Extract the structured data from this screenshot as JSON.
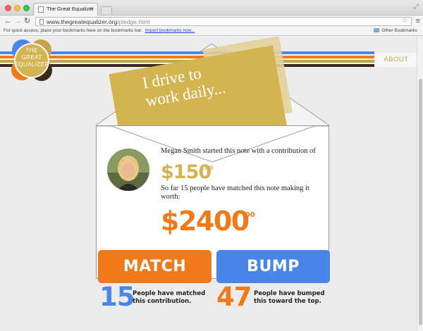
{
  "browser": {
    "tab_title": "The Great Equalizer",
    "url_host": "www.thegreatequalizer.org",
    "url_path": "/pledge.html",
    "bookmarks_hint": "For quick access, place your bookmarks here on the bookmarks bar.",
    "import_link": "Import bookmarks now...",
    "other_bookmarks": "Other Bookmarks"
  },
  "header": {
    "logo_lines": [
      "THE",
      "GREAT",
      "EQUALIZER"
    ],
    "about_label": "ABOUT",
    "stripe_colors": [
      "#4a86e8",
      "#f07a1a",
      "#c9a24e",
      "#3a2a1e"
    ]
  },
  "note": {
    "text": "I drive to\nwork daily..."
  },
  "pledge": {
    "started_text": "Megan Smith started this note with a contribution of",
    "initial_amount": "$150",
    "initial_cents": ".00",
    "matched_text": "So far 15 people have matched this note making it worth:",
    "total_amount": "$2400",
    "total_cents": ".00"
  },
  "actions": {
    "match_label": "MATCH",
    "bump_label": "BUMP",
    "match_count": "15",
    "match_text": "People have matched this contribution.",
    "bump_count": "47",
    "bump_text": "People have bumped this toward the top."
  },
  "colors": {
    "orange": "#f07a1a",
    "blue": "#4a86e8",
    "gold": "#d4b450",
    "dark_brown": "#3a2a1e"
  }
}
